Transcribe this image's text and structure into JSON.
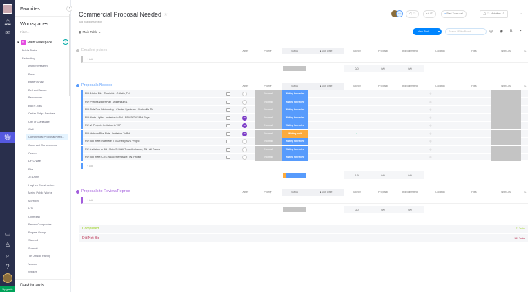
{
  "sidebar": {
    "favorites": "Favorites",
    "workspaces": "Workspaces",
    "filter_placeholder": "Filter...",
    "workspace_badge": "M",
    "workspace": "Main workspace",
    "items": [
      "Briefs Tasks",
      "Estimating",
      "Archer Western",
      "Baxer",
      "Batten Shaw",
      "Bell and Assoc.",
      "Benchmark",
      "BATH Jobs",
      "Cedar Ridge Services",
      "City of Clarksville",
      "Civil",
      "Commercial Proposal Need...",
      "Covenant Constructors",
      "Crown",
      "DF Chase",
      "Dbs",
      "JE Dunn",
      "Hughes Construction",
      "Metro Public Works",
      "McHugh",
      "MTI",
      "Olympian",
      "Reives Companies",
      "Rogers Group",
      "Stansell",
      "Summit",
      "TIR Arnold Paving",
      "Vulcan",
      "Walker"
    ],
    "active_index": 11,
    "dashboards": "Dashboards",
    "upgrade": "Upgrade"
  },
  "header": {
    "title": "Commercial Proposal Needed",
    "description": "Add board description",
    "view": "Main Table",
    "avatar_initials": "CK",
    "updates": "2",
    "likes": "7",
    "zoom": "Start Zoom call",
    "members": "2",
    "activities": "Activities / 0",
    "more": "...",
    "new_task": "New Task",
    "search_placeholder": "Search / Filter Board"
  },
  "columns": [
    "Owner",
    "Priority",
    "Status",
    "Due Date",
    "Takeoff",
    "Proposal",
    "Bid Submitted",
    "Location",
    "Files",
    "Won/Lost",
    "L"
  ],
  "add_label": "+ Add",
  "groups": [
    {
      "name": "Emailed pulses",
      "color": "#c4c4c4",
      "rows": [],
      "summary": [
        "0/0",
        "0/0",
        "0/0"
      ]
    },
    {
      "name": "Proposals Needed",
      "color": "#579bfc",
      "summary": [
        "1/9",
        "0/9",
        "0/9"
      ],
      "rows": [
        {
          "name": "FW: Added File - Dominick - Gallatin, TN",
          "owner": "",
          "priority": "Normal",
          "status": "Waiting for review",
          "takeoff": ""
        },
        {
          "name": "FW: Perkins Water Plan - Addendum 1",
          "owner": "",
          "priority": "Normal",
          "status": "Waiting for review",
          "takeoff": ""
        },
        {
          "name": "FW: Bids Due Wednesday - Charter Spectrum - Clarksville TN -...",
          "owner": "",
          "priority": "Normal",
          "status": "Waiting for review",
          "takeoff": ""
        },
        {
          "name": "FW: North Lights - Invitation to Bid - REVISION 1 Bid Page",
          "owner": "DR",
          "priority": "Normal",
          "status": "Waiting for review",
          "takeoff": ""
        },
        {
          "name": "FW: W Project - Invitation to VFP",
          "owner": "DR",
          "priority": "Normal",
          "status": "Waiting for review",
          "takeoff": ""
        },
        {
          "name": "FW: Hobson Pike Flats - Invitation To Bid",
          "owner": "DR",
          "priority": "Normal",
          "status": "Waiting on it",
          "takeoff": "✓"
        },
        {
          "name": "FW: Bid Invite: Nashville, TN O'Reilly NVS Project",
          "owner": "",
          "priority": "Normal",
          "status": "Waiting for review",
          "takeoff": ""
        },
        {
          "name": "FW: Invitation to Bid - Main St Multi-Tenant-Lebanon, TN - All Trades",
          "owner": "",
          "priority": "Normal",
          "status": "Waiting for review",
          "takeoff": ""
        },
        {
          "name": "FW: Bid Invite: CVS #6635 (Hermitage, TN) Project",
          "owner": "",
          "priority": "Normal",
          "status": "Waiting for review",
          "takeoff": ""
        }
      ]
    },
    {
      "name": "Proposals to Review/Reprice",
      "color": "#a25ddc",
      "rows": [],
      "summary": [
        "0/0",
        "0/0",
        "0/0"
      ]
    }
  ],
  "collapsed": [
    {
      "name": "Completed",
      "count": "71 Tasks",
      "color": "#9cd326"
    },
    {
      "name": "Did Not Bid",
      "count": "149 Tasks",
      "color": "#bb3354"
    }
  ],
  "colors": {
    "status_blue": "#579bfc",
    "status_orange": "#fdab3d",
    "priority_grey": "#c4c4c4"
  }
}
